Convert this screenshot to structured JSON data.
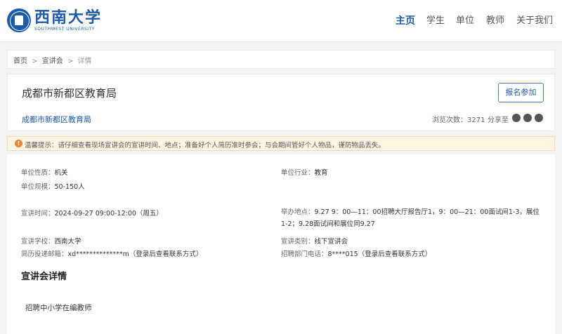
{
  "logo": {
    "cn": "西南大学",
    "en": "SOUTHWEST UNIVERSITY"
  },
  "nav": {
    "home": "主页",
    "students": "学生",
    "employers": "单位",
    "teachers": "教师",
    "about": "关于我们"
  },
  "breadcrumb": {
    "home": "首页",
    "sep1": ">",
    "talks": "宣讲会",
    "sep2": ">",
    "current": "详情"
  },
  "header": {
    "title": "成都市新都区教育局",
    "company_link": "成都市新都区教育局",
    "signup_label": "报名参加",
    "views": "浏览次数：3271",
    "share_label": "分享至"
  },
  "notice": {
    "icon_text": "!",
    "text": "温馨提示：请仔细查看现场宣讲会的宣讲时间、地点；准备好个人简历准时参会；与会期间管好个人物品，谨防物品丢失。"
  },
  "details": {
    "nature_label": "单位性质：",
    "nature": "机关",
    "industry_label": "单位行业：",
    "industry": "教育",
    "scale_label": "单位规模：",
    "scale": "50-150人",
    "time_label": "宣讲时间：",
    "time": "2024-09-27 09:00-12:00（周五）",
    "place_label": "举办地点：",
    "place": "9.27 9：00—11：00招聘大厅报告厅1，9：00—21：00面试间1-3，展位1-2；9.28面试间和展位同9.27",
    "school_label": "宣讲学校：",
    "school": "西南大学",
    "type_label": "宣讲类别：",
    "type": "线下宣讲会",
    "email_label": "简历投递邮箱：",
    "email": "xd**************m（登录后查看联系方式）",
    "phone_label": "招聘部门电话：",
    "phone": "8****015（登录后查看联系方式）"
  },
  "section": {
    "title": "宣讲会详情",
    "content": "招聘中小学在编教师"
  },
  "colors": {
    "brand": "#1d5aa8",
    "notice_bg": "#fdf4e3",
    "warn": "#e8833a"
  }
}
